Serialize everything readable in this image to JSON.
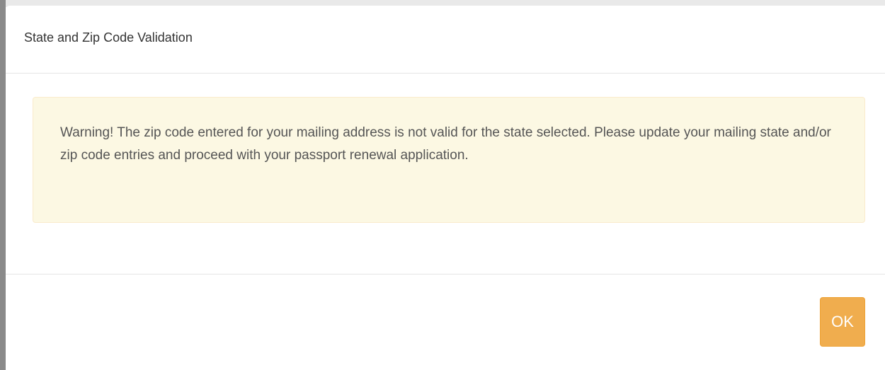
{
  "dialog": {
    "title": "State and Zip Code Validation",
    "message": "Warning! The zip code entered for your mailing address is not valid for the state selected. Please update your mailing state and/or zip code entries and proceed with your passport renewal application.",
    "ok_label": "OK"
  },
  "colors": {
    "alert_background": "#fcf8e3",
    "alert_border": "#faebcc",
    "button_background": "#f0ad4e"
  }
}
